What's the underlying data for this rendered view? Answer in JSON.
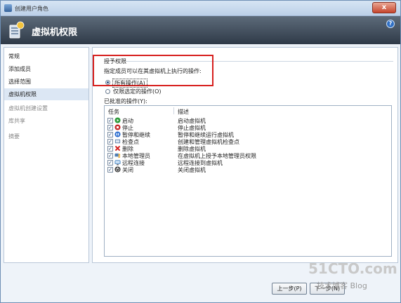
{
  "window": {
    "title": "创建用户角色",
    "close_label": "x"
  },
  "header": {
    "title": "虚拟机权限",
    "help_label": "?"
  },
  "nav": {
    "items": [
      {
        "label": "常规",
        "state": "normal"
      },
      {
        "label": "添加成员",
        "state": "normal"
      },
      {
        "label": "选择范围",
        "state": "normal"
      },
      {
        "label": "虚拟机权限",
        "state": "active"
      },
      {
        "label": "虚拟机创建设置",
        "state": "disabled"
      },
      {
        "label": "库共享",
        "state": "disabled"
      },
      {
        "label": "摘要",
        "state": "disabled"
      }
    ]
  },
  "content": {
    "section_title": "授予权限",
    "description": "指定成员可以在其虚拟机上执行的操作:",
    "radio_all": "所有操作(A)",
    "radio_selected": "仅限选定的操作(O)",
    "list_title": "已批准的操作(Y):",
    "columns": {
      "task": "任务",
      "desc": "描述"
    },
    "rows": [
      {
        "task": "启动",
        "desc": "启动虚拟机",
        "icon": "start-icon",
        "color": "#2e9b3a"
      },
      {
        "task": "停止",
        "desc": "停止虚拟机",
        "icon": "stop-icon",
        "color": "#c62a2a"
      },
      {
        "task": "暂停和继续",
        "desc": "暂停和继续运行虚拟机",
        "icon": "pause-icon",
        "color": "#2a6ccf"
      },
      {
        "task": "检查点",
        "desc": "创建和管理虚拟机检查点",
        "icon": "checkpoint-icon",
        "color": "#5d7da8"
      },
      {
        "task": "删除",
        "desc": "删除虚拟机",
        "icon": "delete-icon",
        "color": "#d42222"
      },
      {
        "task": "本地管理员",
        "desc": "在虚拟机上授予本地管理员权限",
        "icon": "local-admin-icon",
        "color": "#4f7db5"
      },
      {
        "task": "远程连接",
        "desc": "远程连接到虚拟机",
        "icon": "remote-connect-icon",
        "color": "#3f7fbf"
      },
      {
        "task": "关闭",
        "desc": "关闭虚拟机",
        "icon": "shutdown-icon",
        "color": "#333333"
      }
    ]
  },
  "buttons": {
    "prev": "上一步(P)",
    "next": "下一步(N)"
  },
  "watermark": {
    "big": "51CTO.com",
    "small": "技术博客 Blog"
  }
}
